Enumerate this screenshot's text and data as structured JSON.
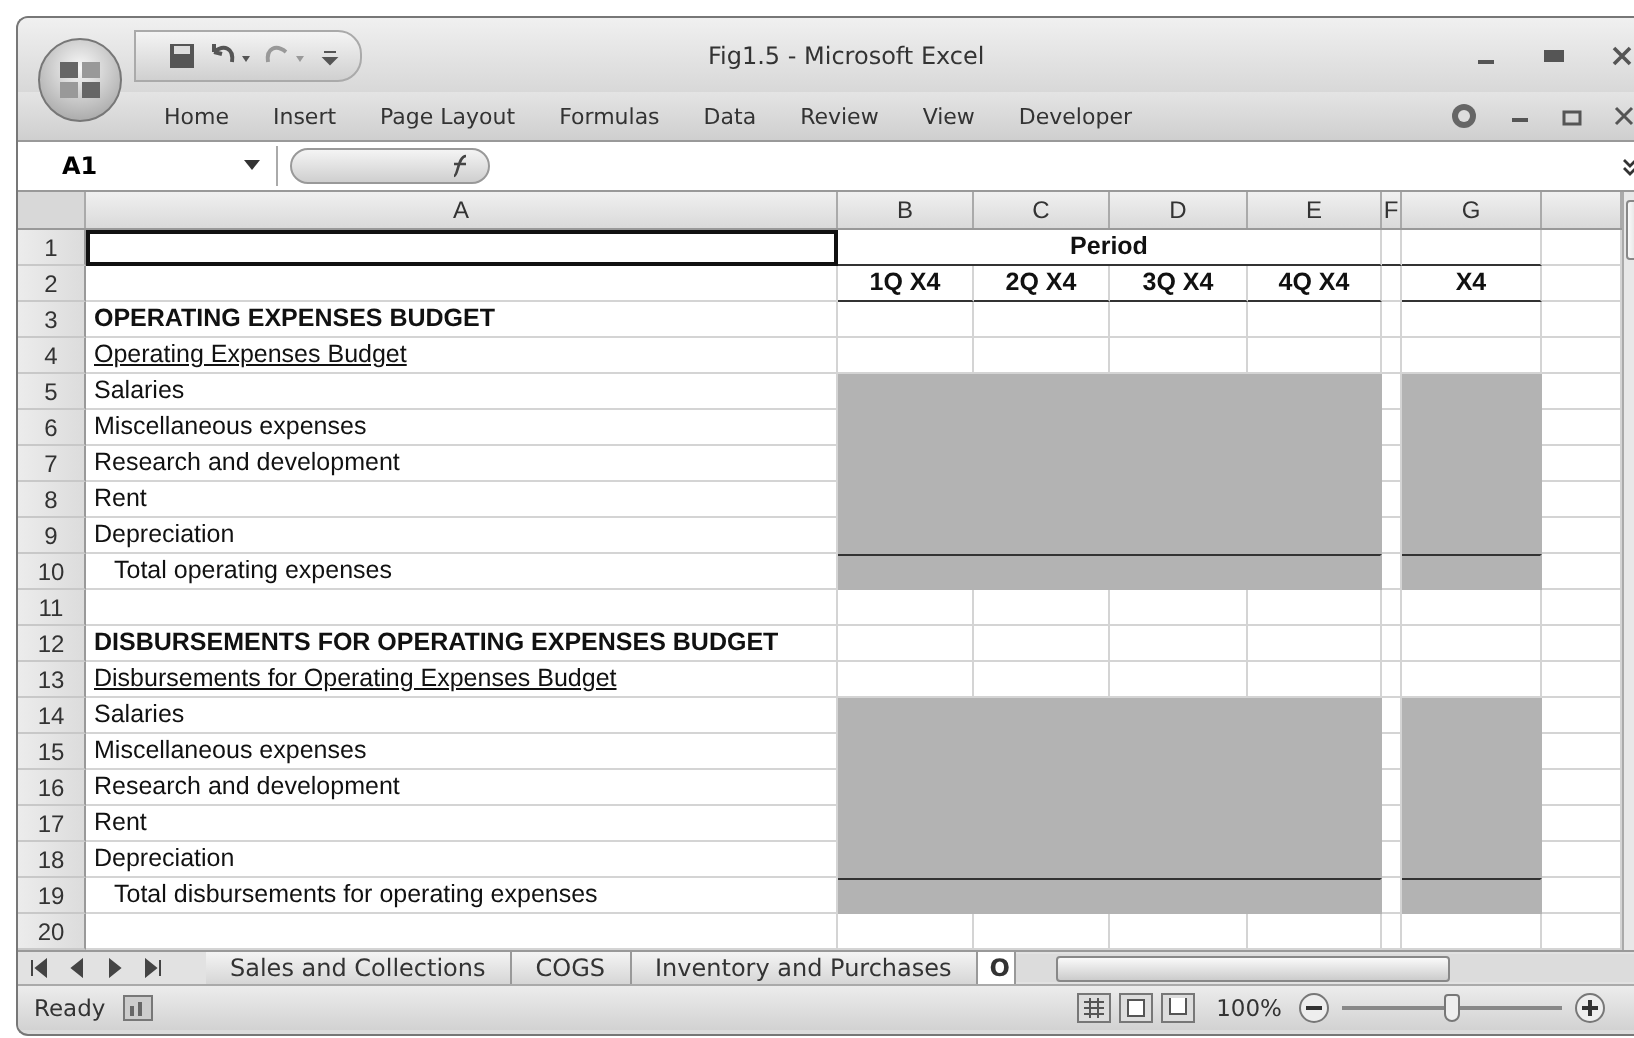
{
  "window": {
    "title": "Fig1.5 - Microsoft Excel"
  },
  "ribbon_tabs": [
    {
      "label": "Home",
      "selected": false
    },
    {
      "label": "Insert",
      "selected": false
    },
    {
      "label": "Page Layout",
      "selected": false
    },
    {
      "label": "Formulas",
      "selected": false
    },
    {
      "label": "Data",
      "selected": false
    },
    {
      "label": "Review",
      "selected": false
    },
    {
      "label": "View",
      "selected": false
    },
    {
      "label": "Developer",
      "selected": false
    }
  ],
  "formula_bar": {
    "name_box": "A1"
  },
  "sheet": {
    "columns": [
      "A",
      "B",
      "C",
      "D",
      "E",
      "F",
      "G"
    ],
    "rows": [
      {
        "number": "1",
        "kind": "period",
        "selected": true,
        "label": "Period"
      },
      {
        "number": "2",
        "kind": "quarters",
        "selected": false,
        "quarters": [
          "1Q X4",
          "2Q X4",
          "3Q X4",
          "4Q X4"
        ],
        "year": "X4"
      },
      {
        "number": "3",
        "kind": "section",
        "selected": false,
        "label": "OPERATING EXPENSES BUDGET"
      },
      {
        "number": "4",
        "kind": "subtitle",
        "selected": false,
        "label": "Operating Expenses Budget"
      },
      {
        "number": "5",
        "kind": "item",
        "selected": false,
        "label": "Salaries"
      },
      {
        "number": "6",
        "kind": "item",
        "selected": false,
        "label": "Miscellaneous expenses"
      },
      {
        "number": "7",
        "kind": "item",
        "selected": false,
        "label": "Research and development"
      },
      {
        "number": "8",
        "kind": "item",
        "selected": false,
        "label": "Rent"
      },
      {
        "number": "9",
        "kind": "item",
        "selected": false,
        "label": "Depreciation"
      },
      {
        "number": "10",
        "kind": "total",
        "selected": false,
        "label": "Total operating expenses"
      },
      {
        "number": "11",
        "kind": "blank",
        "selected": false
      },
      {
        "number": "12",
        "kind": "section",
        "selected": false,
        "label": "DISBURSEMENTS FOR OPERATING EXPENSES BUDGET"
      },
      {
        "number": "13",
        "kind": "subtitle",
        "selected": false,
        "label": "Disbursements for Operating Expenses Budget"
      },
      {
        "number": "14",
        "kind": "item",
        "selected": false,
        "label": "Salaries"
      },
      {
        "number": "15",
        "kind": "item",
        "selected": false,
        "label": "Miscellaneous expenses"
      },
      {
        "number": "16",
        "kind": "item",
        "selected": false,
        "label": "Research and development"
      },
      {
        "number": "17",
        "kind": "item",
        "selected": false,
        "label": "Rent"
      },
      {
        "number": "18",
        "kind": "item",
        "selected": false,
        "label": "Depreciation"
      },
      {
        "number": "19",
        "kind": "total",
        "selected": false,
        "label": "Total disbursements for operating expenses"
      },
      {
        "number": "20",
        "kind": "blank",
        "selected": false
      }
    ]
  },
  "sheet_tabs": [
    {
      "label": "Sales and Collections",
      "selected": false
    },
    {
      "label": "COGS",
      "selected": false
    },
    {
      "label": "Inventory and Purchases",
      "selected": false
    },
    {
      "label": "O",
      "selected": true
    }
  ],
  "status_bar": {
    "status": "Ready",
    "zoom": "100%",
    "zoom_slider": {
      "level": 0.5
    }
  }
}
